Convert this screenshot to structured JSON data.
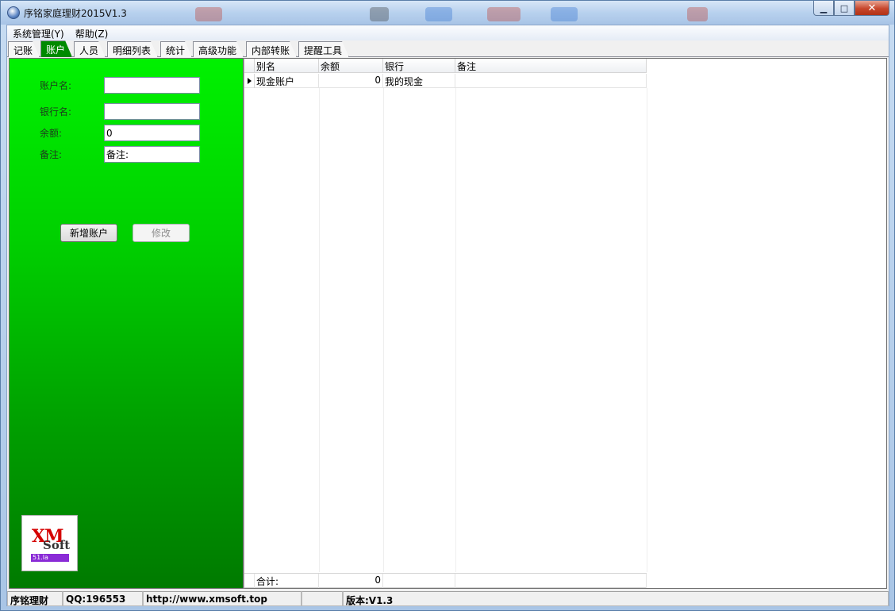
{
  "window": {
    "title": "序铭家庭理财2015V1.3",
    "controls": {
      "minimize": "▁",
      "maximize": "□",
      "close": "✕"
    }
  },
  "menu": [
    {
      "label": "系统管理(Y)"
    },
    {
      "label": "帮助(Z)"
    }
  ],
  "tabs": [
    {
      "label": "记账",
      "active": false
    },
    {
      "label": "账户",
      "active": true
    },
    {
      "label": "人员",
      "active": false
    },
    {
      "label": "明细列表",
      "active": false
    },
    {
      "label": "统计",
      "active": false
    },
    {
      "label": "高级功能",
      "active": false
    },
    {
      "label": "内部转账",
      "active": false
    },
    {
      "label": "提醒工具",
      "active": false
    }
  ],
  "form": {
    "account_name": {
      "label": "账户名:",
      "value": ""
    },
    "bank_name": {
      "label": "银行名:",
      "value": ""
    },
    "balance": {
      "label": "余额:",
      "value": "0"
    },
    "remark": {
      "label": "备注:",
      "value": "备注:"
    },
    "add_button": "新增账户",
    "edit_button": "修改"
  },
  "logo": {
    "main": "XM",
    "sub": "Soft",
    "badge": "51.la"
  },
  "grid": {
    "columns": [
      "别名",
      "余额",
      "银行",
      "备注"
    ],
    "rows": [
      {
        "alias": "现金账户",
        "balance": "0",
        "bank": "我的现金",
        "remark": ""
      }
    ],
    "footer": {
      "label": "合计:",
      "total": "0"
    }
  },
  "statusbar": {
    "name": "序铭理财",
    "qq": "QQ:196553",
    "url": "http://www.xmsoft.top",
    "empty": "",
    "version": "版本:V1.3"
  },
  "colors": {
    "panel_top": "#00f100",
    "panel_bottom": "#007a00",
    "active_tab": "#008a00"
  }
}
